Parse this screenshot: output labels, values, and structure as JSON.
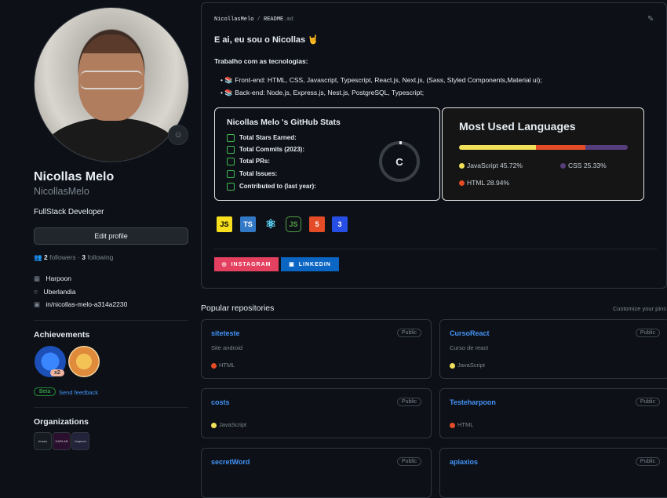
{
  "profile": {
    "name": "Nicollas Melo",
    "username": "NicollasMelo",
    "bio": "FullStack Developer",
    "edit_label": "Edit profile",
    "followers_count": "2",
    "followers_label": "followers",
    "sep": "·",
    "following_count": "3",
    "following_label": "following",
    "company": "Harpoon",
    "location": "Uberlandia",
    "linkedin": "in/nicollas-melo-a314a2230",
    "achievements_title": "Achievements",
    "achievement_multiplier": "x2",
    "beta_label": "Beta",
    "feedback_label": "Send feedback",
    "orgs_title": "Organizations",
    "orgs": [
      "bossa",
      "HARLAB",
      "harpoon"
    ]
  },
  "readme": {
    "path_user": "NicollasMelo",
    "path_sep": "/",
    "path_file": "README",
    "path_ext": ".md",
    "greeting": "E ai, eu sou o Nicollas 🤘",
    "tech_heading": "Trabalho com as tecnologias:",
    "items": [
      "📚 Front-end: HTML, CSS, Javascript, Typescript, React.js, Next.js, (Sass, Styled Components,Material ui);",
      "📚 Back-end: Node.js, Express.js, Nest.js, PostgreSQL, Typescript;"
    ],
    "stats": {
      "title": "Nicollas Melo 's GitHub Stats",
      "rows": [
        "Total Stars Earned:",
        "Total Commits (2023):",
        "Total PRs:",
        "Total Issues:",
        "Contributed to (last year):"
      ],
      "grade": "C",
      "grade_progress": 0.02
    },
    "langs": {
      "title": "Most Used Languages",
      "items": [
        {
          "label": "JavaScript 45.72%",
          "value": 45.72,
          "color": "#f1e05a"
        },
        {
          "label": "HTML 28.94%",
          "value": 28.94,
          "color": "#e34c26"
        },
        {
          "label": "CSS 25.33%",
          "value": 25.33,
          "color": "#563d7c"
        }
      ]
    },
    "tech_icons": [
      "JS",
      "TS",
      "⚛",
      "JS",
      "5",
      "3"
    ],
    "social": [
      {
        "label": "INSTAGRAM",
        "color": "#E4405F"
      },
      {
        "label": "LINKEDIN",
        "color": "#0A66C2"
      }
    ]
  },
  "repos": {
    "title": "Popular repositories",
    "customize": "Customize your pins",
    "items": [
      {
        "name": "siteteste",
        "visibility": "Public",
        "desc": "Site android",
        "lang": "HTML",
        "color": "#e34c26"
      },
      {
        "name": "CursoReact",
        "visibility": "Public",
        "desc": "Curso de react",
        "lang": "JavaScript",
        "color": "#f1e05a"
      },
      {
        "name": "costs",
        "visibility": "Public",
        "desc": "",
        "lang": "JavaScript",
        "color": "#f1e05a"
      },
      {
        "name": "Testeharpoon",
        "visibility": "Public",
        "desc": "",
        "lang": "HTML",
        "color": "#e34c26"
      },
      {
        "name": "secretWord",
        "visibility": "Public",
        "desc": "",
        "lang": "",
        "color": ""
      },
      {
        "name": "apiaxios",
        "visibility": "Public",
        "desc": "",
        "lang": "",
        "color": ""
      }
    ]
  }
}
